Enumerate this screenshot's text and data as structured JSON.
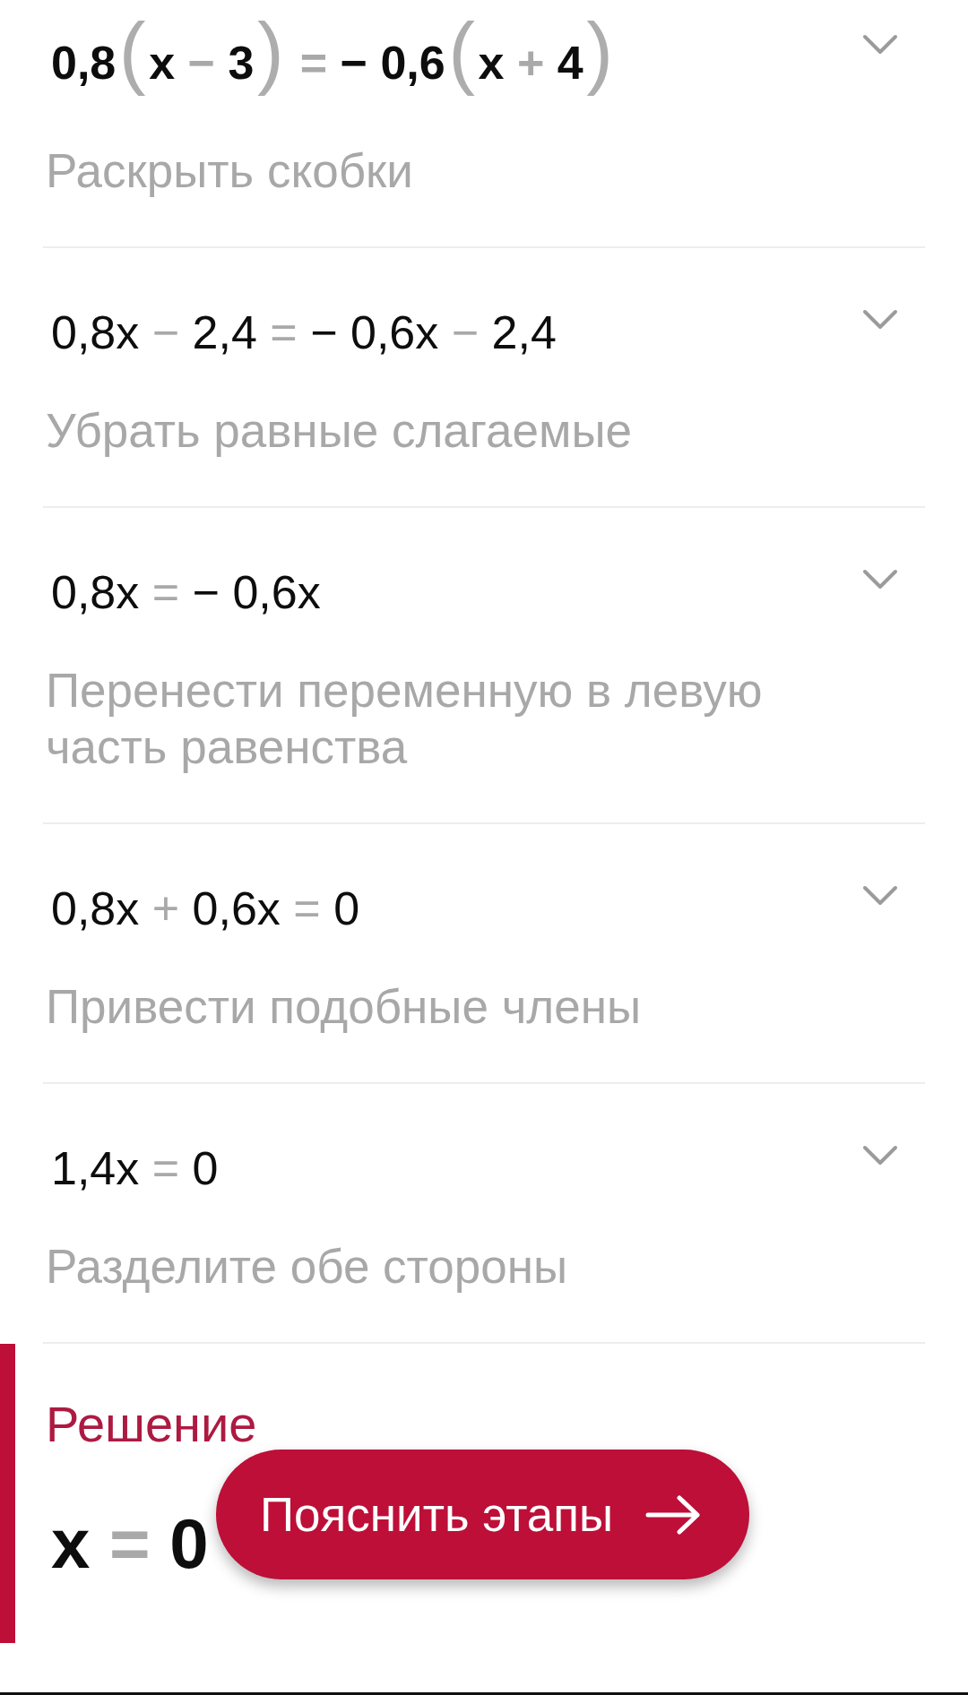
{
  "steps": [
    {
      "expression": [
        {
          "text": "0,8",
          "kind": "term"
        },
        {
          "text": "(",
          "kind": "open_paren"
        },
        {
          "text": "x",
          "kind": "term"
        },
        {
          "text": "−",
          "kind": "operator"
        },
        {
          "text": "3",
          "kind": "term"
        },
        {
          "text": ")",
          "kind": "close_paren"
        },
        {
          "text": "=",
          "kind": "operator"
        },
        {
          "text": "−",
          "kind": "sign"
        },
        {
          "text": "0,6",
          "kind": "term"
        },
        {
          "text": "(",
          "kind": "open_paren"
        },
        {
          "text": "x",
          "kind": "term"
        },
        {
          "text": "+",
          "kind": "operator"
        },
        {
          "text": "4",
          "kind": "term"
        },
        {
          "text": ")",
          "kind": "close_paren"
        }
      ],
      "emphasized": true,
      "description": "Раскрыть скобки",
      "expanded": false
    },
    {
      "expression": [
        {
          "text": "0,8x",
          "kind": "term"
        },
        {
          "text": "−",
          "kind": "operator"
        },
        {
          "text": "2,4",
          "kind": "term"
        },
        {
          "text": "=",
          "kind": "operator"
        },
        {
          "text": "−",
          "kind": "sign"
        },
        {
          "text": "0,6x",
          "kind": "term"
        },
        {
          "text": "−",
          "kind": "operator"
        },
        {
          "text": "2,4",
          "kind": "term"
        }
      ],
      "emphasized": false,
      "description": "Убрать равные слагаемые",
      "expanded": false
    },
    {
      "expression": [
        {
          "text": "0,8x",
          "kind": "term"
        },
        {
          "text": "=",
          "kind": "operator"
        },
        {
          "text": "−",
          "kind": "sign"
        },
        {
          "text": "0,6x",
          "kind": "term"
        }
      ],
      "emphasized": false,
      "description": "Перенести переменную в левую часть равенства",
      "expanded": false
    },
    {
      "expression": [
        {
          "text": "0,8x",
          "kind": "term"
        },
        {
          "text": "+",
          "kind": "operator"
        },
        {
          "text": "0,6x",
          "kind": "term"
        },
        {
          "text": "=",
          "kind": "operator"
        },
        {
          "text": "0",
          "kind": "term"
        }
      ],
      "emphasized": false,
      "description": "Привести подобные члены",
      "expanded": false
    },
    {
      "expression": [
        {
          "text": "1,4x",
          "kind": "term"
        },
        {
          "text": "=",
          "kind": "operator"
        },
        {
          "text": "0",
          "kind": "term"
        }
      ],
      "emphasized": false,
      "description": "Разделите обе стороны",
      "expanded": false
    }
  ],
  "solution": {
    "title": "Решение",
    "expression": [
      {
        "text": "x",
        "kind": "term"
      },
      {
        "text": "=",
        "kind": "operator"
      },
      {
        "text": "0",
        "kind": "term"
      }
    ]
  },
  "explain_button": {
    "label": "Пояснить этапы"
  }
}
